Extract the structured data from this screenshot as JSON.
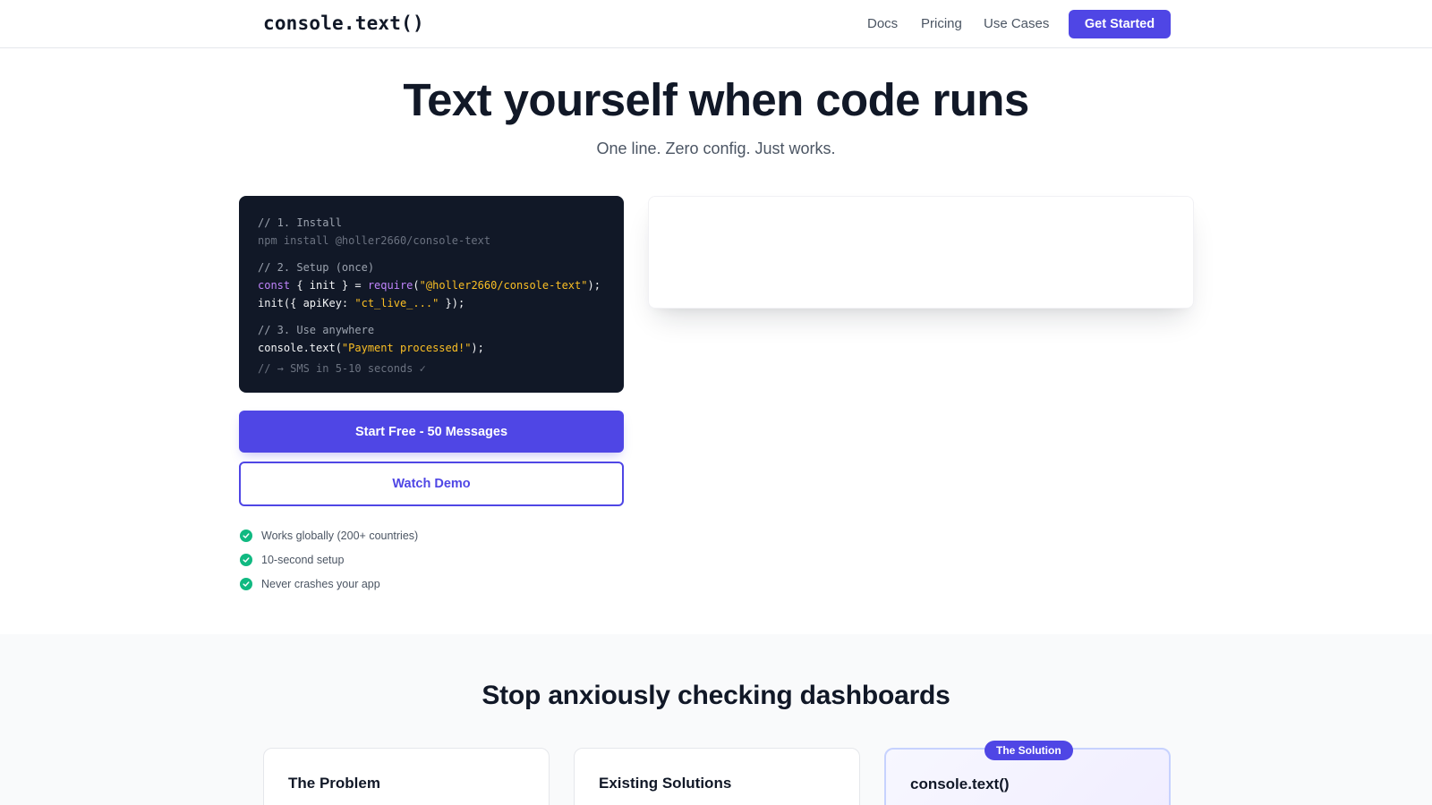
{
  "header": {
    "logo": "console.text()",
    "nav": [
      {
        "label": "Docs"
      },
      {
        "label": "Pricing"
      },
      {
        "label": "Use Cases"
      }
    ],
    "cta_label": "Get Started"
  },
  "hero": {
    "title": "Text yourself when code runs",
    "subtitle": "One line. Zero config. Just works."
  },
  "code": {
    "comment_install": "// 1. Install",
    "install_cmd": "npm install @holler2660/console-text",
    "comment_setup": "// 2. Setup (once)",
    "setup_const": "const",
    "setup_mid": " { init } = ",
    "setup_require": "require",
    "setup_paren_open": "(",
    "setup_pkg": "\"@holler2660/console-text\"",
    "setup_end": ");",
    "init_start": "init({ apiKey: ",
    "init_key": "\"ct_live_...\"",
    "init_end": " });",
    "comment_use": "// 3. Use anywhere",
    "use_start": "console.text(",
    "use_msg": "\"Payment processed!\"",
    "use_end": ");",
    "comment_result": "// → SMS in 5-10 seconds ✓"
  },
  "buttons": {
    "primary_label": "Start Free - 50 Messages",
    "secondary_label": "Watch Demo"
  },
  "features": [
    {
      "text": "Works globally (200+ countries)"
    },
    {
      "text": "10-second setup"
    },
    {
      "text": "Never crashes your app"
    }
  ],
  "section2": {
    "title": "Stop anxiously checking dashboards",
    "cards": [
      {
        "title": "The Problem"
      },
      {
        "title": "Existing Solutions"
      },
      {
        "title": "console.text()",
        "badge": "The Solution"
      }
    ]
  },
  "colors": {
    "accent": "#4f46e5",
    "success": "#10b981",
    "code_bg": "#111827"
  }
}
